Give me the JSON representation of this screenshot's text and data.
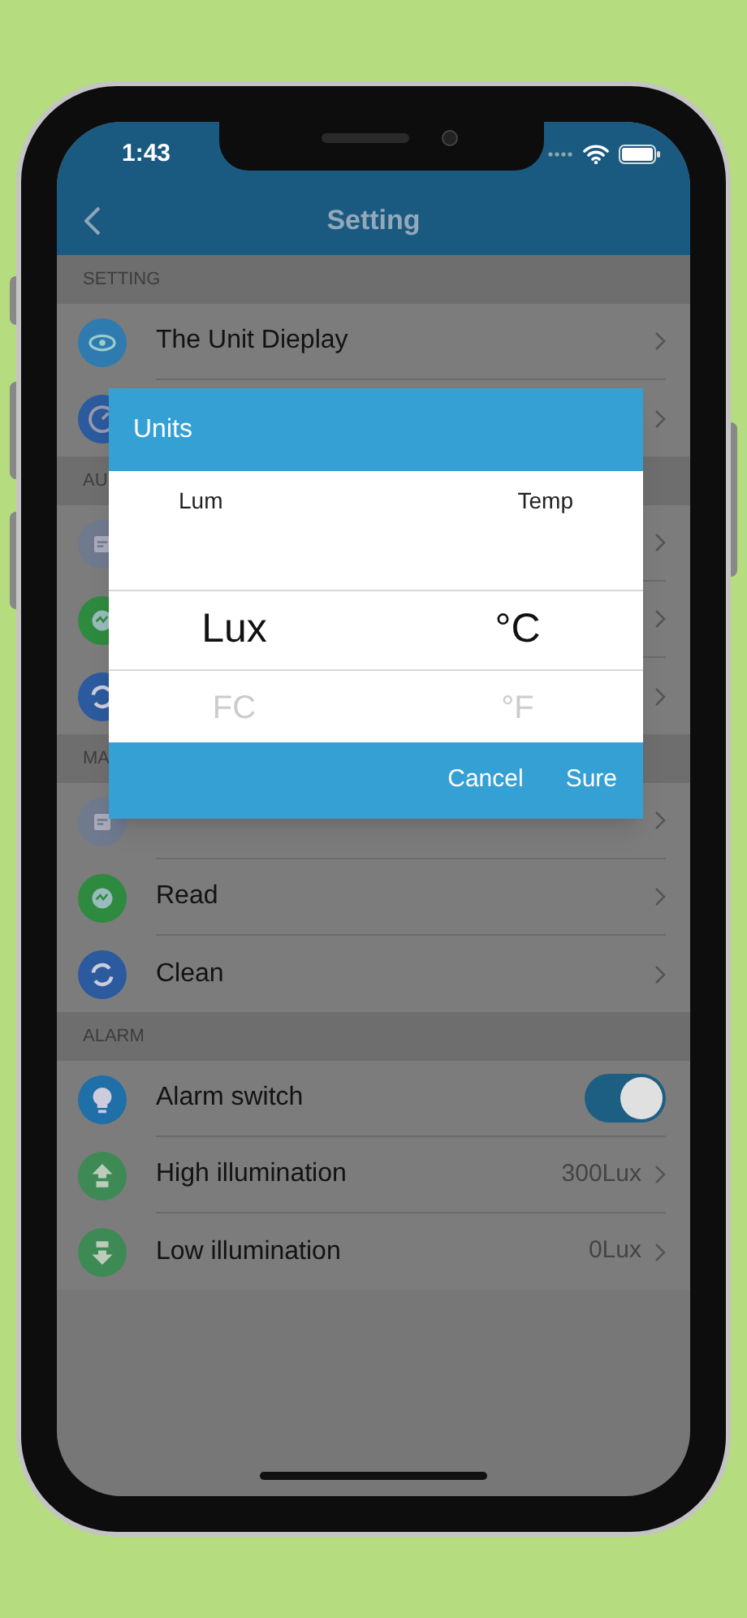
{
  "status_bar": {
    "time": "1:43"
  },
  "nav_bar": {
    "title": "Setting"
  },
  "sections": [
    {
      "header": "SETTING",
      "items": [
        {
          "kind": "link",
          "label": "The Unit Dieplay",
          "color": "#2f7bb0"
        },
        {
          "kind": "link",
          "color": "#2b5a9e"
        }
      ]
    },
    {
      "header": "AU",
      "items": [
        {
          "kind": "link",
          "color": "#6f7a8f"
        },
        {
          "kind": "link",
          "color": "#2e8a3e"
        },
        {
          "kind": "link",
          "color": "#2b5a9e"
        }
      ]
    },
    {
      "header": "MA",
      "items": [
        {
          "kind": "link",
          "color": "#6f7a8f"
        },
        {
          "kind": "link",
          "label": "Read",
          "color": "#2e8a3e"
        },
        {
          "kind": "link",
          "label": "Clean",
          "color": "#2b5a9e"
        }
      ]
    },
    {
      "header": "ALARM",
      "items": [
        {
          "kind": "switch",
          "label": "Alarm switch",
          "on": true,
          "color": "#1f6fa8"
        },
        {
          "kind": "link",
          "label": "High illumination",
          "value": "300Lux",
          "color": "#3e8a55"
        },
        {
          "kind": "link",
          "label": "Low illumination",
          "value": "0Lux",
          "color": "#3e8a55"
        }
      ]
    }
  ],
  "dialog": {
    "title": "Units",
    "columns": [
      {
        "label": "Lum",
        "options": [
          {
            "text": "Lux",
            "selected": true
          },
          {
            "text": "FC",
            "selected": false
          }
        ]
      },
      {
        "label": "Temp",
        "options": [
          {
            "text": "°C",
            "selected": true
          },
          {
            "text": "°F",
            "selected": false
          }
        ]
      }
    ],
    "buttons": [
      "Cancel",
      "Sure"
    ]
  }
}
